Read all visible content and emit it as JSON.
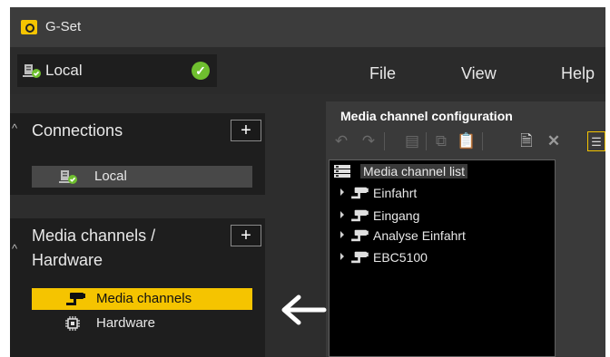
{
  "titlebar": {
    "app_title": "G-Set",
    "app_icon": "gset-logo-icon"
  },
  "connection": {
    "label": "Local",
    "status": "connected",
    "status_icon": "check-circle-icon"
  },
  "menu": [
    {
      "label": "File"
    },
    {
      "label": "View"
    },
    {
      "label": "Help"
    }
  ],
  "sidebar": {
    "connections": {
      "title": "Connections",
      "add_label": "+",
      "items": [
        {
          "label": "Local",
          "icon": "local-server-icon"
        }
      ]
    },
    "media": {
      "title_line1": "Media channels /",
      "title_line2": "Hardware",
      "add_label": "+",
      "items": [
        {
          "label": "Media channels",
          "icon": "camera-icon",
          "selected": true
        },
        {
          "label": "Hardware",
          "icon": "chip-icon"
        }
      ]
    }
  },
  "panel": {
    "title": "Media channel configuration",
    "list_root": "Media channel list",
    "channels": [
      {
        "label": "Einfahrt"
      },
      {
        "label": "Eingang"
      },
      {
        "label": "Analyse Einfahrt"
      },
      {
        "label": "EBC5100"
      }
    ]
  },
  "colors": {
    "accent": "#f5c400",
    "status_ok": "#6fbf2f",
    "background": "#2d2d2d",
    "list_background": "#000000"
  }
}
